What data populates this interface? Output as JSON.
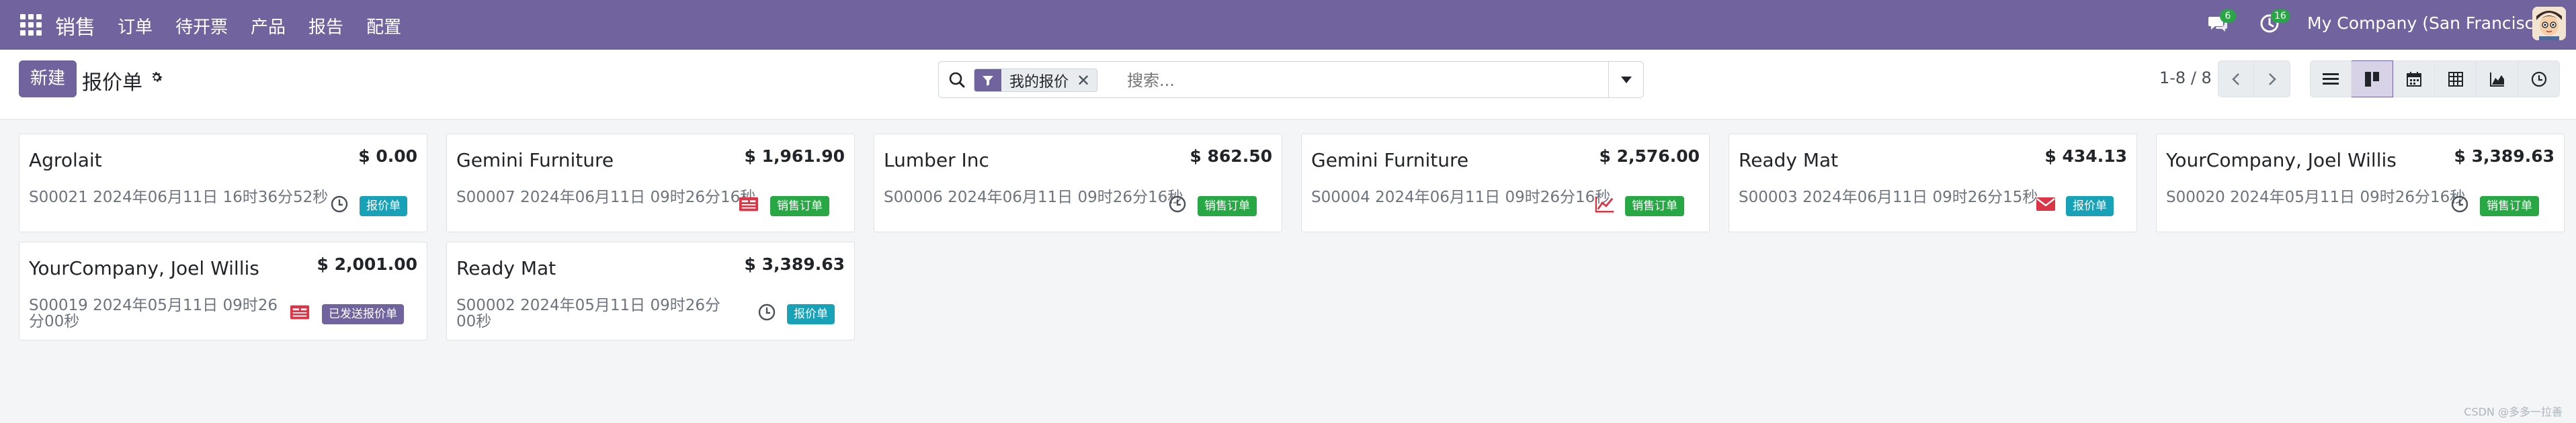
{
  "navbar": {
    "brand": "销售",
    "menu": [
      "订单",
      "待开票",
      "产品",
      "报告",
      "配置"
    ],
    "chat_badge": "6",
    "activity_badge": "16",
    "company": "My Company (San Francisco)"
  },
  "control": {
    "new_label": "新建",
    "title": "报价单",
    "facet_label": "我的报价",
    "search_placeholder": "搜索...",
    "pager": "1-8 / 8"
  },
  "cards": [
    {
      "name": "Agrolait",
      "amount": "$ 0.00",
      "ref": "S00021 2024年06月11日 16时36分52秒",
      "tag": "报价单",
      "tag_color": "#17a2b8",
      "activity": "clock-icon"
    },
    {
      "name": "Gemini Furniture",
      "amount": "$ 1,961.90",
      "ref": "S00007 2024年06月11日 09时26分16秒",
      "tag": "销售订单",
      "tag_color": "#28a745",
      "activity": "invoice-icon"
    },
    {
      "name": "Lumber Inc",
      "amount": "$ 862.50",
      "ref": "S00006 2024年06月11日 09时26分16秒",
      "tag": "销售订单",
      "tag_color": "#28a745",
      "activity": "clock-icon"
    },
    {
      "name": "Gemini Furniture",
      "amount": "$ 2,576.00",
      "ref": "S00004 2024年06月11日 09时26分16秒",
      "tag": "销售订单",
      "tag_color": "#28a745",
      "activity": "chart-line-icon"
    },
    {
      "name": "Ready Mat",
      "amount": "$ 434.13",
      "ref": "S00003 2024年06月11日 09时26分15秒",
      "tag": "报价单",
      "tag_color": "#17a2b8",
      "activity": "envelope-icon"
    },
    {
      "name": "YourCompany, Joel Willis",
      "amount": "$ 3,389.63",
      "ref": "S00020 2024年05月11日 09时26分16秒",
      "tag": "销售订单",
      "tag_color": "#28a745",
      "activity": "clock-icon"
    },
    {
      "name": "YourCompany, Joel Willis",
      "amount": "$ 2,001.00",
      "ref": "S00019 2024年05月11日 09时26分00秒",
      "tag": "已发送报价单",
      "tag_color": "#71639e",
      "activity": "invoice-icon"
    },
    {
      "name": "Ready Mat",
      "amount": "$ 3,389.63",
      "ref": "S00002 2024年05月11日 09时26分00秒",
      "tag": "报价单",
      "tag_color": "#17a2b8",
      "activity": "clock-icon"
    }
  ],
  "watermark": "CSDN @多多一拉善"
}
